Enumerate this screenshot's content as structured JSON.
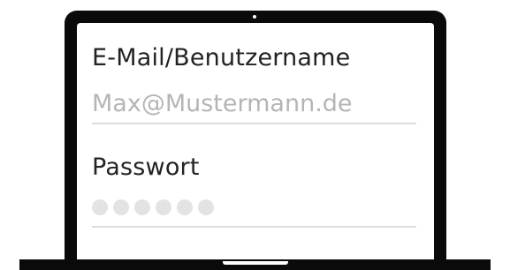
{
  "login_form": {
    "email_label": "E-Mail/Benutzername",
    "email_placeholder": "Max@Mustermann.de",
    "password_label": "Passwort",
    "password_mask_count": 6
  },
  "colors": {
    "device_frame": "#0a0a0a",
    "label_text": "#222222",
    "placeholder_text": "#b5b5b5",
    "field_underline": "#dcdcdc",
    "password_dots": "#e3e3e3"
  },
  "icons": {
    "camera": "camera-icon"
  }
}
